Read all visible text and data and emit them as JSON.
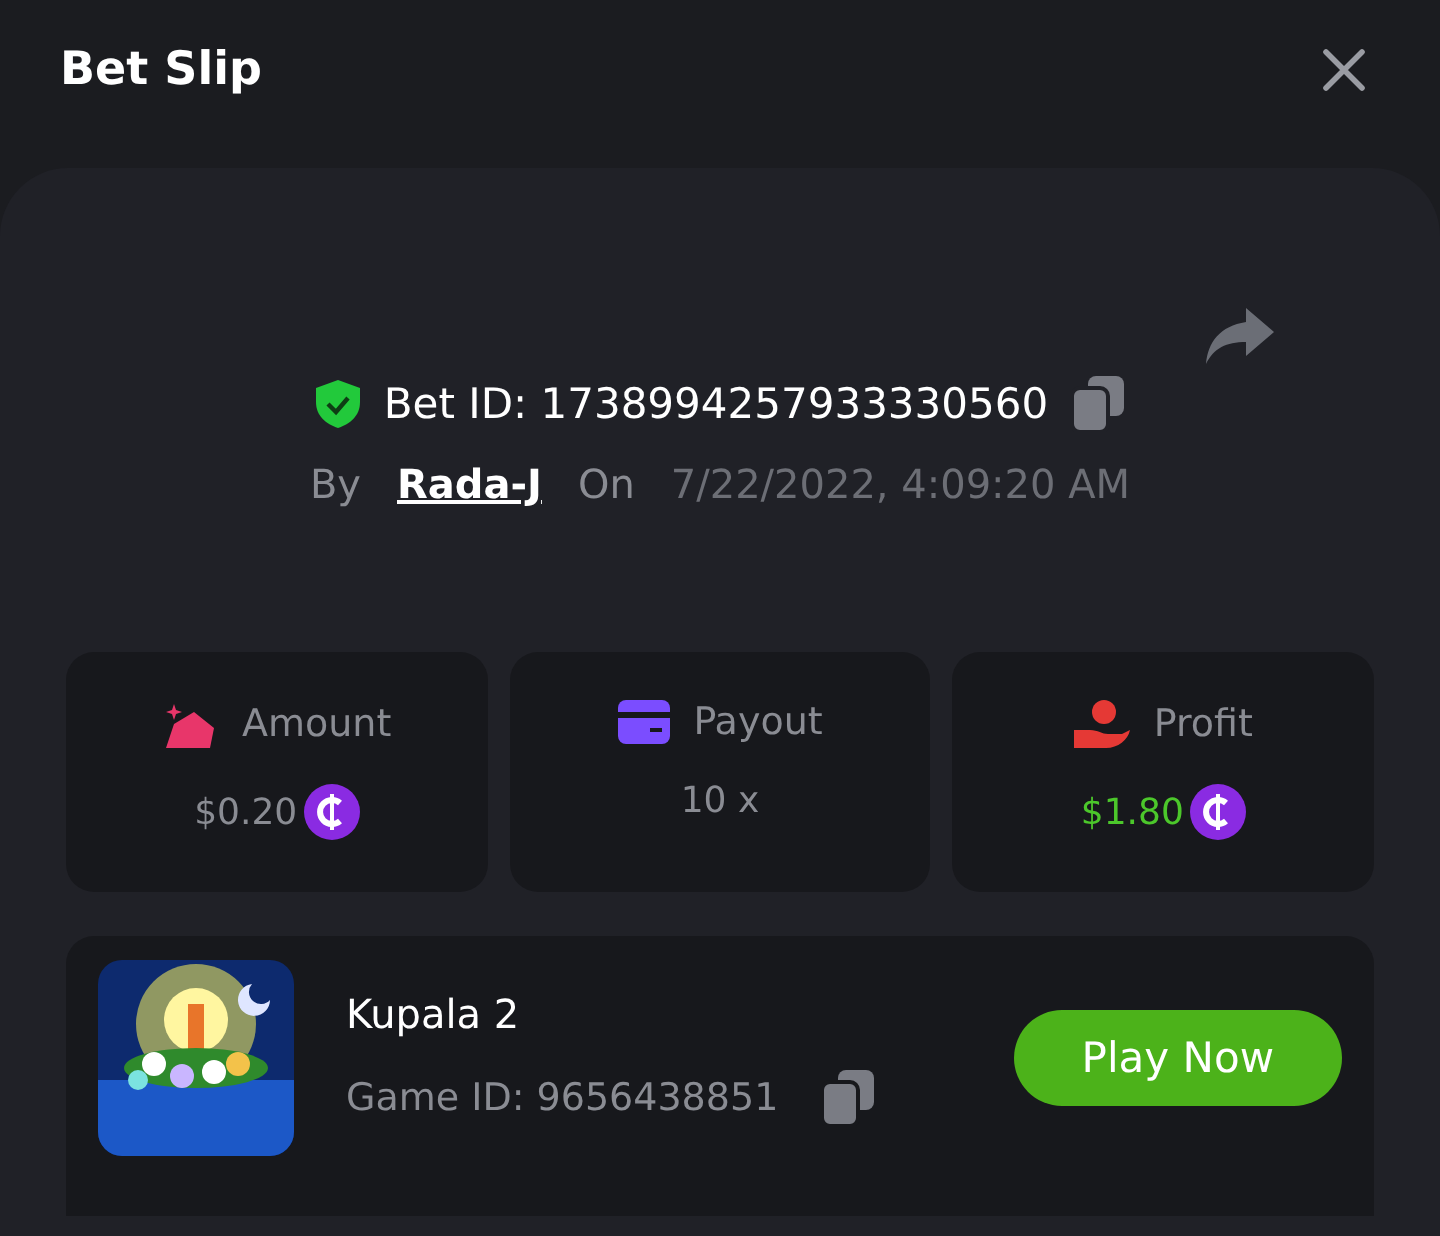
{
  "header": {
    "title": "Bet Slip"
  },
  "bet": {
    "verified": true,
    "id_label": "Bet ID: 1738994257933330560",
    "by_label": "By",
    "user": "Rada-J",
    "on_label": "On",
    "date": "7/22/2022, 4:09:20 AM"
  },
  "stats": [
    {
      "kind": "amount",
      "label": "Amount",
      "value": "$0.20",
      "coin": true,
      "positive": false,
      "color": "#e8366a"
    },
    {
      "kind": "payout",
      "label": "Payout",
      "value": "10 x",
      "coin": false,
      "positive": false,
      "color": "#7b4dff"
    },
    {
      "kind": "profit",
      "label": "Profit",
      "value": "$1.80",
      "coin": true,
      "positive": true,
      "color": "#e53935"
    }
  ],
  "game": {
    "name": "Kupala 2",
    "id_label": "Game ID: 9656438851",
    "button": "Play Now"
  }
}
